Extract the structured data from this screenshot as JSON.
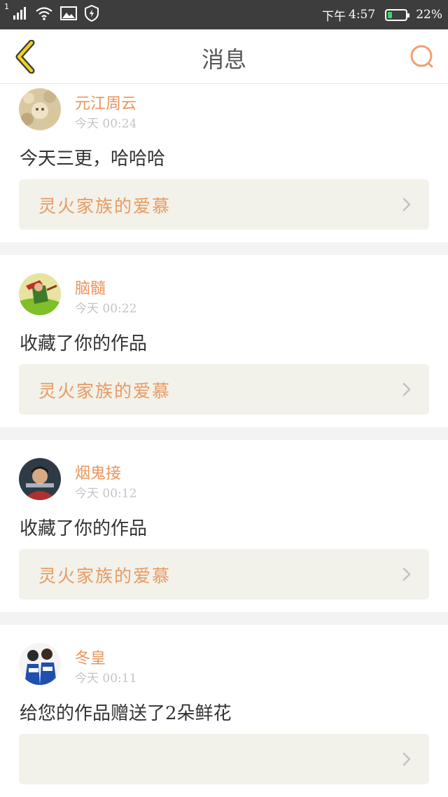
{
  "status_bar": {
    "sim_label": "1",
    "time_period": "下午",
    "time": "4:57",
    "battery_level": "22%",
    "battery_color": "#3cd46a"
  },
  "header": {
    "title": "消息",
    "back_icon": "chevron-left-icon",
    "search_icon": "search-icon",
    "accent_color": "#e8955a"
  },
  "messages": [
    {
      "username": "元江周云",
      "timestamp": "今天 00:24",
      "text": "今天三更，哈哈哈",
      "work_title": "灵火家族的爱慕"
    },
    {
      "username": "脑髓",
      "timestamp": "今天 00:22",
      "text": "收藏了你的作品",
      "work_title": "灵火家族的爱慕"
    },
    {
      "username": "烟鬼接",
      "timestamp": "今天 00:12",
      "text": "收藏了你的作品",
      "work_title": "灵火家族的爱慕"
    },
    {
      "username": "冬皇",
      "timestamp": "今天 00:11",
      "text": "给您的作品赠送了2朵鲜花",
      "work_title": ""
    }
  ]
}
